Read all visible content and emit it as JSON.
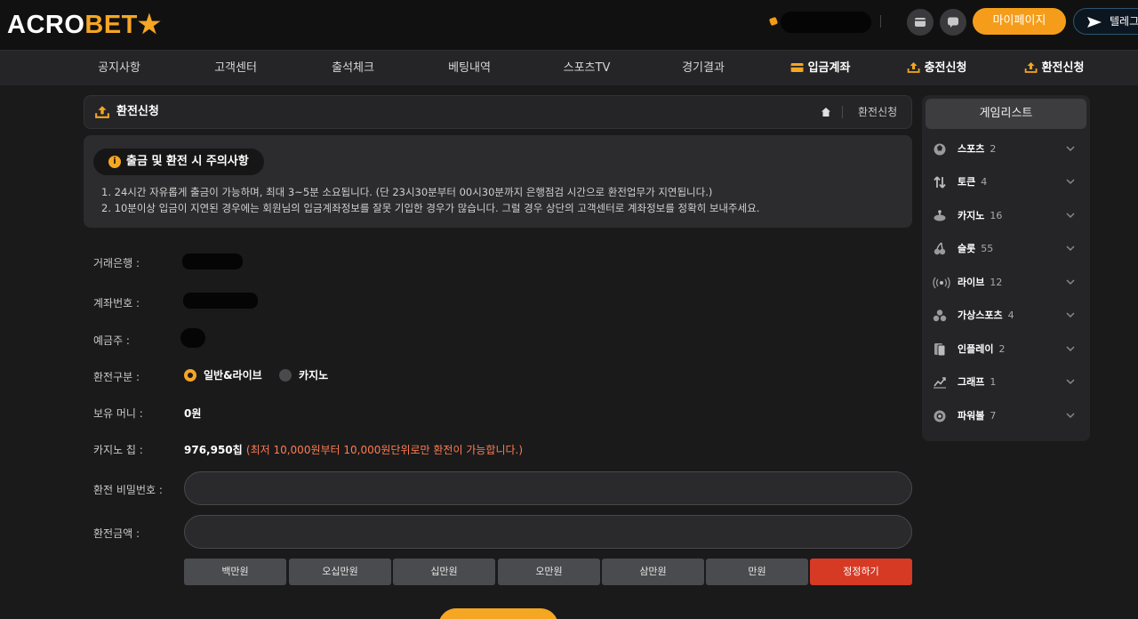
{
  "brand": {
    "logo_white": "ACRO",
    "logo_gold": "BET",
    "logo_star": "★"
  },
  "header": {
    "mypage_label": "마이페이지",
    "telegram_label": "텔레그"
  },
  "nav": [
    {
      "label": "공지사항"
    },
    {
      "label": "고객센터"
    },
    {
      "label": "출석체크"
    },
    {
      "label": "베팅내역"
    },
    {
      "label": "스포츠TV"
    },
    {
      "label": "경기결과"
    },
    {
      "label": "입금계좌",
      "icon": "card-icon"
    },
    {
      "label": "충전신청",
      "icon": "upload-icon"
    },
    {
      "label": "환전신청",
      "icon": "upload-icon"
    }
  ],
  "page": {
    "title": "환전신청",
    "breadcrumb_current": "환전신청"
  },
  "notice": {
    "title": "출금 및 환전 시 주의사항",
    "lines": [
      "1. 24시간 자유롭게 출금이 가능하며, 최대 3~5분 소요됩니다. (단 23시30분부터 00시30분까지 은행점검 시간으로 환전업무가 지연됩니다.)",
      "2. 10분이상 입금이 지연된 경우에는 회원님의 입금계좌정보를 잘못 기입한 경우가 많습니다. 그럴 경우 상단의 고객센터로 계좌정보를 정확히 보내주세요."
    ]
  },
  "form": {
    "bank_label": "거래은행 :",
    "account_label": "계좌번호 :",
    "holder_label": "예금주 :",
    "type_label": "환전구분 :",
    "type_options": [
      "일반&라이브",
      "카지노"
    ],
    "type_selected": "일반&라이브",
    "money_label": "보유 머니 :",
    "money_value": "0원",
    "chip_label": "카지노 칩 :",
    "chip_value": "976,950칩",
    "chip_warning": "(최저 10,000원부터 10,000원단위로만 환전이 가능합니다.)",
    "password_label": "환전 비밀번호 :",
    "password_value": "",
    "amount_label": "환전금액 :",
    "amount_value": ""
  },
  "amount_buttons": [
    "백만원",
    "오십만원",
    "십만원",
    "오만원",
    "삼만원",
    "만원",
    "정정하기"
  ],
  "game_list": {
    "title": "게임리스트",
    "items": [
      {
        "name": "스포츠",
        "count": "2",
        "icon": "sports-icon"
      },
      {
        "name": "토큰",
        "count": "4",
        "icon": "token-icon"
      },
      {
        "name": "카지노",
        "count": "16",
        "icon": "casino-icon"
      },
      {
        "name": "슬롯",
        "count": "55",
        "icon": "slot-icon"
      },
      {
        "name": "라이브",
        "count": "12",
        "icon": "live-icon"
      },
      {
        "name": "가상스포츠",
        "count": "4",
        "icon": "virtual-sports-icon"
      },
      {
        "name": "인플레이",
        "count": "2",
        "icon": "inplay-icon"
      },
      {
        "name": "그래프",
        "count": "1",
        "icon": "graph-icon"
      },
      {
        "name": "파워볼",
        "count": "7",
        "icon": "powerball-icon"
      }
    ]
  },
  "colors": {
    "accent": "#f5a623",
    "danger": "#d63a25",
    "warning_text": "#ff7b50",
    "bg": "#1a1a1b",
    "panel": "#252527"
  }
}
